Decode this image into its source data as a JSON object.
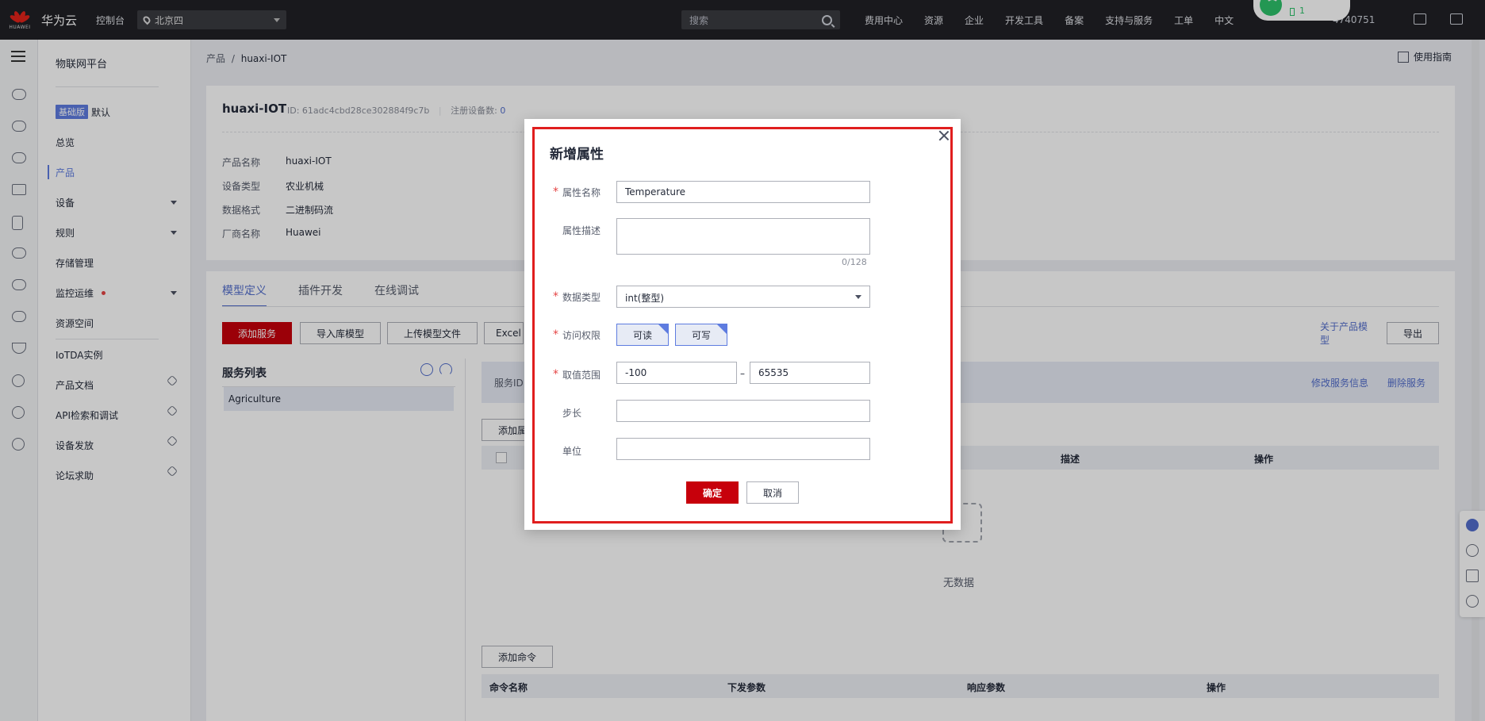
{
  "topbar": {
    "brand": "华为云",
    "console": "控制台",
    "region": "北京四",
    "search_placeholder": "搜索",
    "nav": [
      "费用中心",
      "资源",
      "企业",
      "开发工具",
      "备案",
      "支持与服务",
      "工单",
      "中文"
    ],
    "phone": "4740751",
    "wifi_count": "1"
  },
  "sidebar": {
    "title": "物联网平台",
    "edition_badge": "基础版",
    "edition_name": "默认",
    "items": [
      "总览",
      "产品",
      "设备",
      "规则",
      "存储管理",
      "监控运维",
      "资源空间",
      "IoTDA实例",
      "产品文档",
      "API检索和调试",
      "设备发放",
      "论坛求助"
    ]
  },
  "breadcrumb": {
    "root": "产品",
    "sep": "/",
    "current": "huaxi-IOT"
  },
  "guide": "使用指南",
  "product": {
    "name": "huaxi-IOT",
    "id_label": "ID:",
    "id": "61adc4cbd28ce302884f9c7b",
    "reg_label": "注册设备数:",
    "reg_count": "0",
    "fields": [
      {
        "k": "产品名称",
        "v": "huaxi-IOT"
      },
      {
        "k": "设备类型",
        "v": "农业机械"
      },
      {
        "k": "数据格式",
        "v": "二进制码流"
      },
      {
        "k": "厂商名称",
        "v": "Huawei"
      }
    ]
  },
  "tabs": [
    "模型定义",
    "插件开发",
    "在线调试"
  ],
  "toolbar": {
    "add_service": "添加服务",
    "import_lib": "导入库模型",
    "upload_model": "上传模型文件",
    "excel": "Excel",
    "about_model": "关于产品模型",
    "export": "导出"
  },
  "services": {
    "title": "服务列表",
    "items": [
      "Agriculture"
    ],
    "head_label": "服务ID",
    "edit_info": "修改服务信息",
    "delete": "删除服务",
    "add_prop": "添加属",
    "prop_cols": {
      "desc": "描述",
      "ops": "操作"
    },
    "empty": "无数据",
    "add_cmd": "添加命令",
    "cmd_cols": [
      "命令名称",
      "下发参数",
      "响应参数",
      "操作"
    ]
  },
  "dialog": {
    "title": "新增属性",
    "name_label": "属性名称",
    "name_value": "Temperature",
    "desc_label": "属性描述",
    "desc_value": "",
    "desc_counter": "0/128",
    "type_label": "数据类型",
    "type_value": "int(整型)",
    "access_label": "访问权限",
    "read": "可读",
    "write": "可写",
    "range_label": "取值范围",
    "range_min": "-100",
    "range_sep": "–",
    "range_max": "65535",
    "step_label": "步长",
    "step_value": "",
    "unit_label": "单位",
    "unit_value": "",
    "ok": "确定",
    "cancel": "取消"
  },
  "colors": {
    "brand_red": "#c7000b",
    "accent_blue": "#526ecc",
    "highlight": "#e01e1e"
  }
}
